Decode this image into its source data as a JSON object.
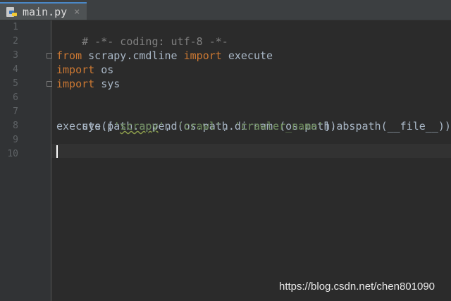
{
  "tab": {
    "filename": "main.py",
    "icon": "python-file-icon",
    "close": "×"
  },
  "gutter": {
    "line_numbers": [
      "1",
      "2",
      "3",
      "4",
      "5",
      "6",
      "7",
      "8",
      "9",
      "10"
    ]
  },
  "code": {
    "line1": "# -*- coding: utf-8 -*-",
    "line3": {
      "kw1": "from",
      "mid": " scrapy.cmdline ",
      "kw2": "import",
      "end": " execute"
    },
    "line4": {
      "kw": "import",
      "rest": " os"
    },
    "line5": {
      "kw": "import",
      "rest": " sys"
    },
    "line7": "sys.path.append(os.path.dirname(os.path.abspath(__file__)))",
    "line8": {
      "open": "execute([",
      "q1": "'",
      "s1": "scrapy",
      "q1b": "'",
      "sep1": ", ",
      "s2": "'crawl'",
      "sep2": ", ",
      "s3": "'crawler_name'",
      "close": "])"
    }
  },
  "watermark": "https://blog.csdn.net/chen801090",
  "colors": {
    "background": "#2b2b2b",
    "keyword": "#cc7832",
    "comment": "#808080",
    "string": "#6a8759",
    "text": "#a9b7c6"
  }
}
